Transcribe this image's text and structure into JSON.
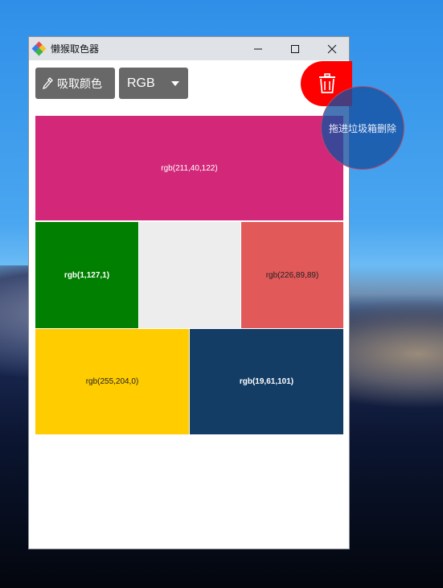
{
  "window": {
    "title": "懒猴取色器",
    "icon": "app-logo-icon",
    "controls": {
      "minimize": "—",
      "maximize": "☐",
      "close": "✕"
    }
  },
  "toolbar": {
    "pick_label": "吸取颜色",
    "pick_icon": "eyedropper-icon",
    "mode_value": "RGB",
    "trash_icon": "trash-icon",
    "trash_color": "#ff0000"
  },
  "drop_hint": "拖进垃圾箱删除",
  "swatches": [
    {
      "label": "rgb(211,40,122)",
      "color": "#d3287a"
    },
    {
      "label": "rgb(1,127,1)",
      "color": "#017f01"
    },
    {
      "label": "",
      "color": "#ededed"
    },
    {
      "label": "rgb(226,89,89)",
      "color": "#e25959"
    },
    {
      "label": "rgb(255,204,0)",
      "color": "#ffcc00"
    },
    {
      "label": "rgb(19,61,101)",
      "color": "#133d65"
    }
  ]
}
